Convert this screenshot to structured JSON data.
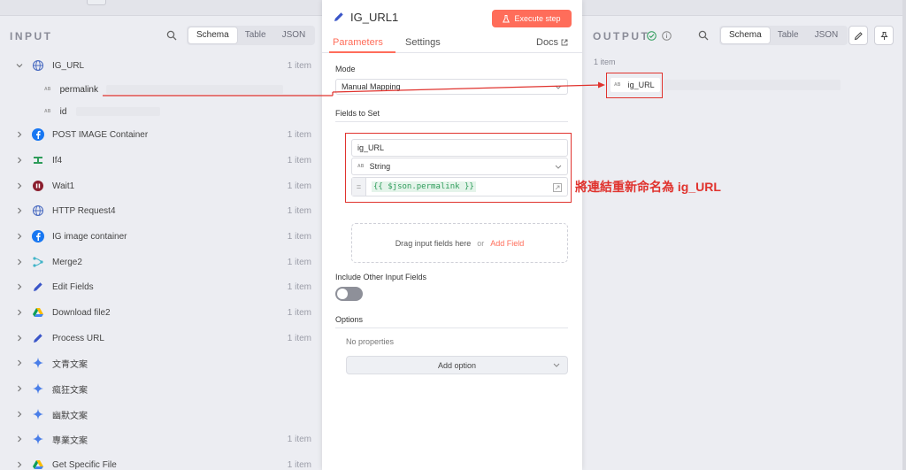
{
  "input_panel": {
    "title": "INPUT",
    "view_tabs": [
      "Schema",
      "Table",
      "JSON"
    ],
    "active_tab": "Schema",
    "tree": [
      {
        "label": "IG_URL",
        "count": "1 item",
        "icon": "globe-icon",
        "expanded": true
      },
      {
        "label": "POST IMAGE Container",
        "count": "1 item",
        "icon": "facebook-icon"
      },
      {
        "label": "If4",
        "count": "1 item",
        "icon": "if-icon"
      },
      {
        "label": "Wait1",
        "count": "1 item",
        "icon": "wait-icon"
      },
      {
        "label": "HTTP Request4",
        "count": "1 item",
        "icon": "globe-icon"
      },
      {
        "label": "IG image container",
        "count": "1 item",
        "icon": "facebook-icon"
      },
      {
        "label": "Merge2",
        "count": "1 item",
        "icon": "merge-icon"
      },
      {
        "label": "Edit Fields",
        "count": "1 item",
        "icon": "pencil-icon"
      },
      {
        "label": "Download file2",
        "count": "1 item",
        "icon": "google-drive-icon"
      },
      {
        "label": "Process URL",
        "count": "1 item",
        "icon": "pencil-icon"
      },
      {
        "label": "文青文案",
        "count": "",
        "icon": "gemini-icon"
      },
      {
        "label": "瘋狂文案",
        "count": "",
        "icon": "gemini-icon"
      },
      {
        "label": "幽默文案",
        "count": "",
        "icon": "gemini-icon"
      },
      {
        "label": "專業文案",
        "count": "1 item",
        "icon": "gemini-icon"
      },
      {
        "label": "Get Specific File",
        "count": "1 item",
        "icon": "google-drive-icon"
      }
    ],
    "ig_url_fields": [
      {
        "type_tag": "AB",
        "name": "permalink"
      },
      {
        "type_tag": "AB",
        "name": "id"
      }
    ]
  },
  "node_panel": {
    "title": "IG_URL1",
    "execute_label": "Execute step",
    "tabs": [
      "Parameters",
      "Settings"
    ],
    "active_tab": "Parameters",
    "docs_label": "Docs",
    "mode_label": "Mode",
    "mode_value": "Manual Mapping",
    "fields_to_set_label": "Fields to Set",
    "field": {
      "name": "ig_URL",
      "type_tag": "AB",
      "type": "String",
      "expr_prefix": "=",
      "expression": "{{ $json.permalink }}"
    },
    "drag_hint": "Drag input fields here",
    "drag_or": "or",
    "add_field_label": "Add Field",
    "include_other_label": "Include Other Input Fields",
    "include_other_on": false,
    "options_label": "Options",
    "no_properties": "No properties",
    "add_option_label": "Add option"
  },
  "output_panel": {
    "title": "OUTPUT",
    "view_tabs": [
      "Schema",
      "Table",
      "JSON"
    ],
    "active_tab": "Schema",
    "item_count": "1 item",
    "field": {
      "type_tag": "AB",
      "name": "ig_URL"
    }
  },
  "annotation": {
    "text": "將連結重新命名為 ig_URL",
    "color": "#e0332e"
  },
  "colors": {
    "accent": "#ff6d5a",
    "expression_green": "#2e9c5a",
    "annotation_red": "#e0332e"
  }
}
